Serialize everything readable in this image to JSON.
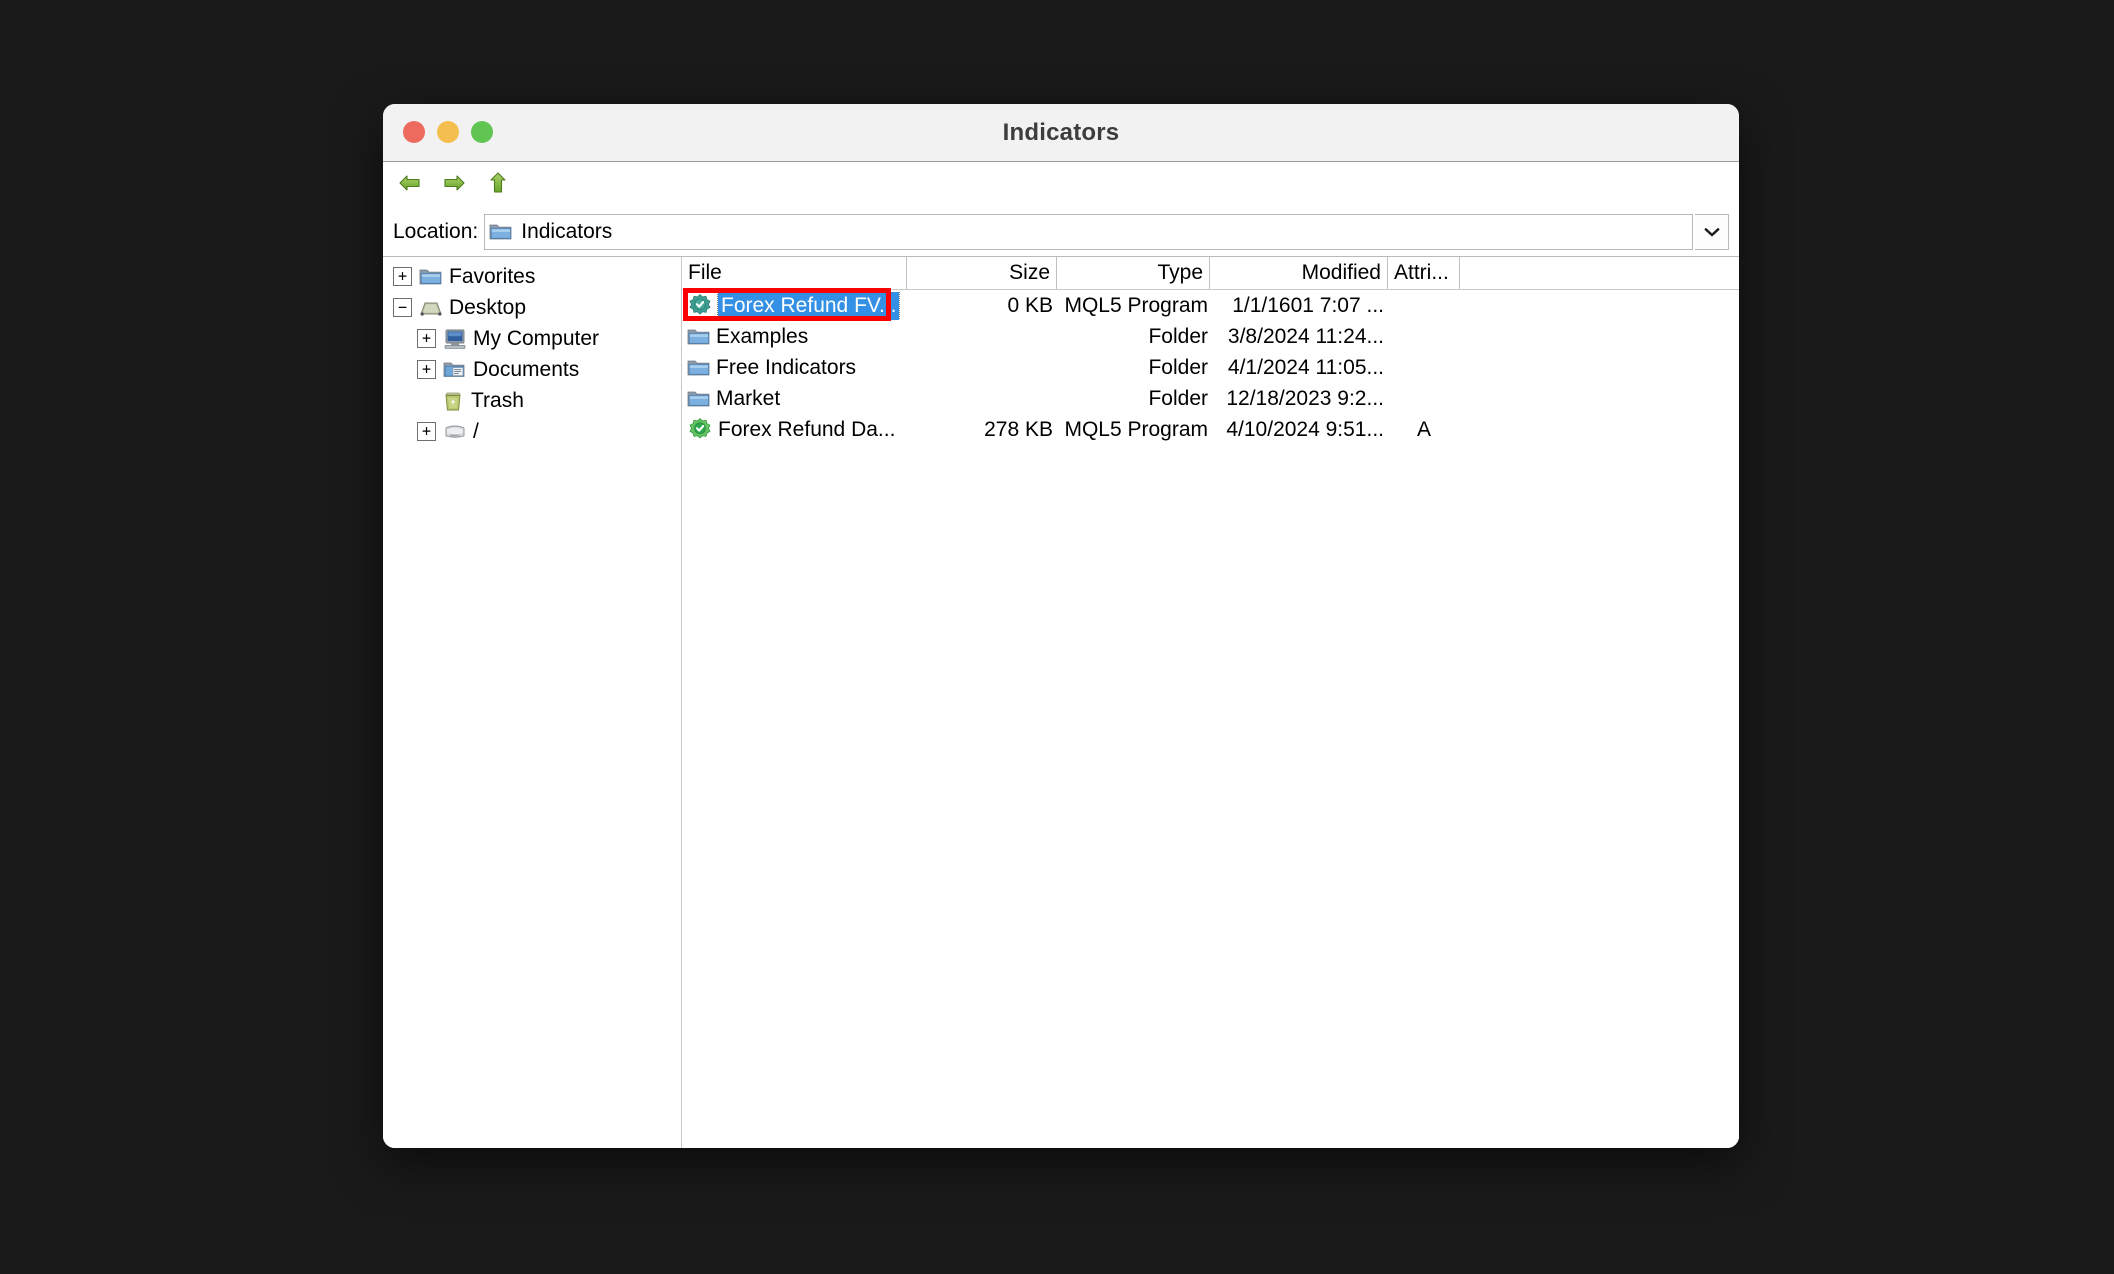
{
  "window": {
    "title": "Indicators",
    "traffic_lights": [
      "close",
      "minimize",
      "maximize"
    ]
  },
  "toolbar": {
    "back_label": "Back",
    "forward_label": "Forward",
    "up_label": "Up one level"
  },
  "location": {
    "label": "Location:",
    "value": "Indicators",
    "dropdown_glyph": "⌄"
  },
  "tree": {
    "items": [
      {
        "label": "Favorites",
        "expander": "+",
        "indent": 0,
        "icon": "folder-icon"
      },
      {
        "label": "Desktop",
        "expander": "−",
        "indent": 0,
        "icon": "desktop-icon"
      },
      {
        "label": "My Computer",
        "expander": "+",
        "indent": 1,
        "icon": "computer-icon"
      },
      {
        "label": "Documents",
        "expander": "+",
        "indent": 1,
        "icon": "documents-icon"
      },
      {
        "label": "Trash",
        "expander": "",
        "indent": 1,
        "icon": "trash-icon"
      },
      {
        "label": "/",
        "expander": "+",
        "indent": 1,
        "icon": "drive-icon"
      }
    ]
  },
  "file_list": {
    "columns": [
      "File",
      "Size",
      "Type",
      "Modified",
      "Attri..."
    ],
    "rows": [
      {
        "name": "Forex Refund FV...",
        "size": "0 KB",
        "type": "MQL5 Program",
        "modified": "1/1/1601 7:07 ...",
        "attributes": "",
        "icon": "mql5-program-icon-teal",
        "selected": true,
        "annotated": true
      },
      {
        "name": "Examples",
        "size": "",
        "type": "Folder",
        "modified": "3/8/2024 11:24...",
        "attributes": "",
        "icon": "folder-icon",
        "selected": false,
        "annotated": false
      },
      {
        "name": "Free Indicators",
        "size": "",
        "type": "Folder",
        "modified": "4/1/2024 11:05...",
        "attributes": "",
        "icon": "folder-icon",
        "selected": false,
        "annotated": false
      },
      {
        "name": "Market",
        "size": "",
        "type": "Folder",
        "modified": "12/18/2023 9:2...",
        "attributes": "",
        "icon": "folder-icon",
        "selected": false,
        "annotated": false
      },
      {
        "name": "Forex Refund Da...",
        "size": "278 KB",
        "type": "MQL5 Program",
        "modified": "4/10/2024 9:51...",
        "attributes": "A",
        "icon": "mql5-program-icon-green",
        "selected": false,
        "annotated": false
      }
    ]
  },
  "colors": {
    "selection_blue": "#3390e4",
    "annotation_red": "#fa0000",
    "titlebar_bg": "#f2f2f2",
    "close_red": "#ed6a5f",
    "minimize_yellow": "#f5bf4f",
    "maximize_green": "#61c554",
    "folder_blue": "#5b9bd5",
    "mql5_green": "#49b749",
    "mql5_teal": "#3a9e90",
    "desktop_bg": "#1a1a1a"
  }
}
